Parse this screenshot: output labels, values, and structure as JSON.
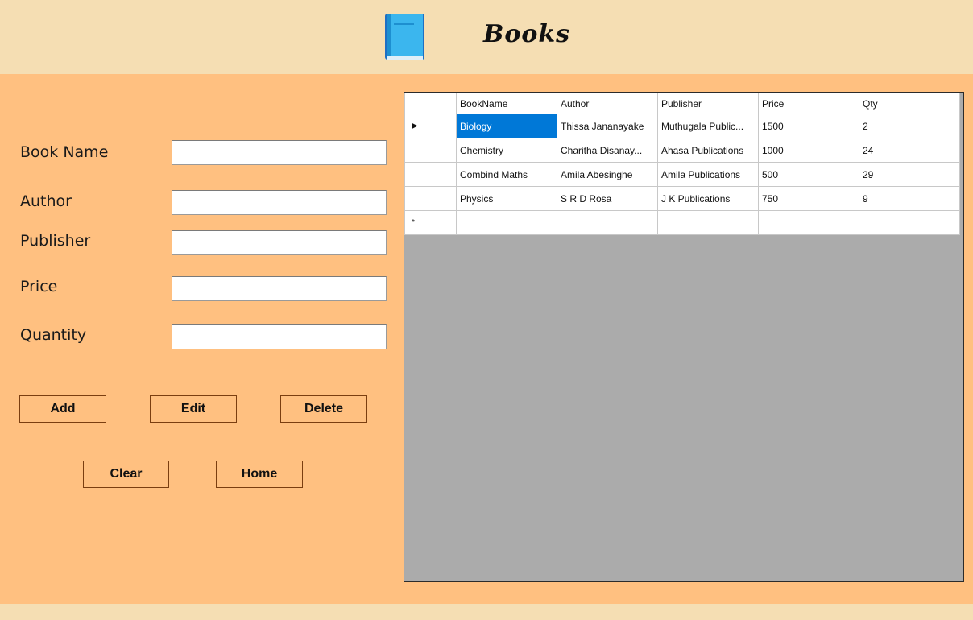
{
  "header": {
    "title": "Books",
    "icon": "book-icon"
  },
  "form": {
    "labels": {
      "book_name": "Book Name",
      "author": "Author",
      "publisher": "Publisher",
      "price": "Price",
      "quantity": "Quantity"
    },
    "values": {
      "book_name": "",
      "author": "",
      "publisher": "",
      "price": "",
      "quantity": ""
    }
  },
  "buttons": {
    "add": "Add",
    "edit": "Edit",
    "delete": "Delete",
    "clear": "Clear",
    "home": "Home"
  },
  "grid": {
    "columns": [
      "BookName",
      "Author",
      "Publisher",
      "Price",
      "Qty"
    ],
    "rows": [
      [
        "Biology",
        "Thissa Jananayake",
        "Muthugala Public...",
        "1500",
        "2"
      ],
      [
        "Chemistry",
        "Charitha Disanay...",
        "Ahasa Publications",
        "1000",
        "24"
      ],
      [
        "Combind Maths",
        "Amila Abesinghe",
        "Amila Publications",
        "500",
        "29"
      ],
      [
        "Physics",
        "S R D Rosa",
        "J K Publications",
        "750",
        "9"
      ]
    ],
    "current_row_marker": "▶",
    "new_row_marker": "*",
    "selected_cell_color": "#0078d7"
  },
  "colors": {
    "background": "#ffc080",
    "header_bar": "#f5deb3",
    "grid_empty_area": "#ababab"
  }
}
